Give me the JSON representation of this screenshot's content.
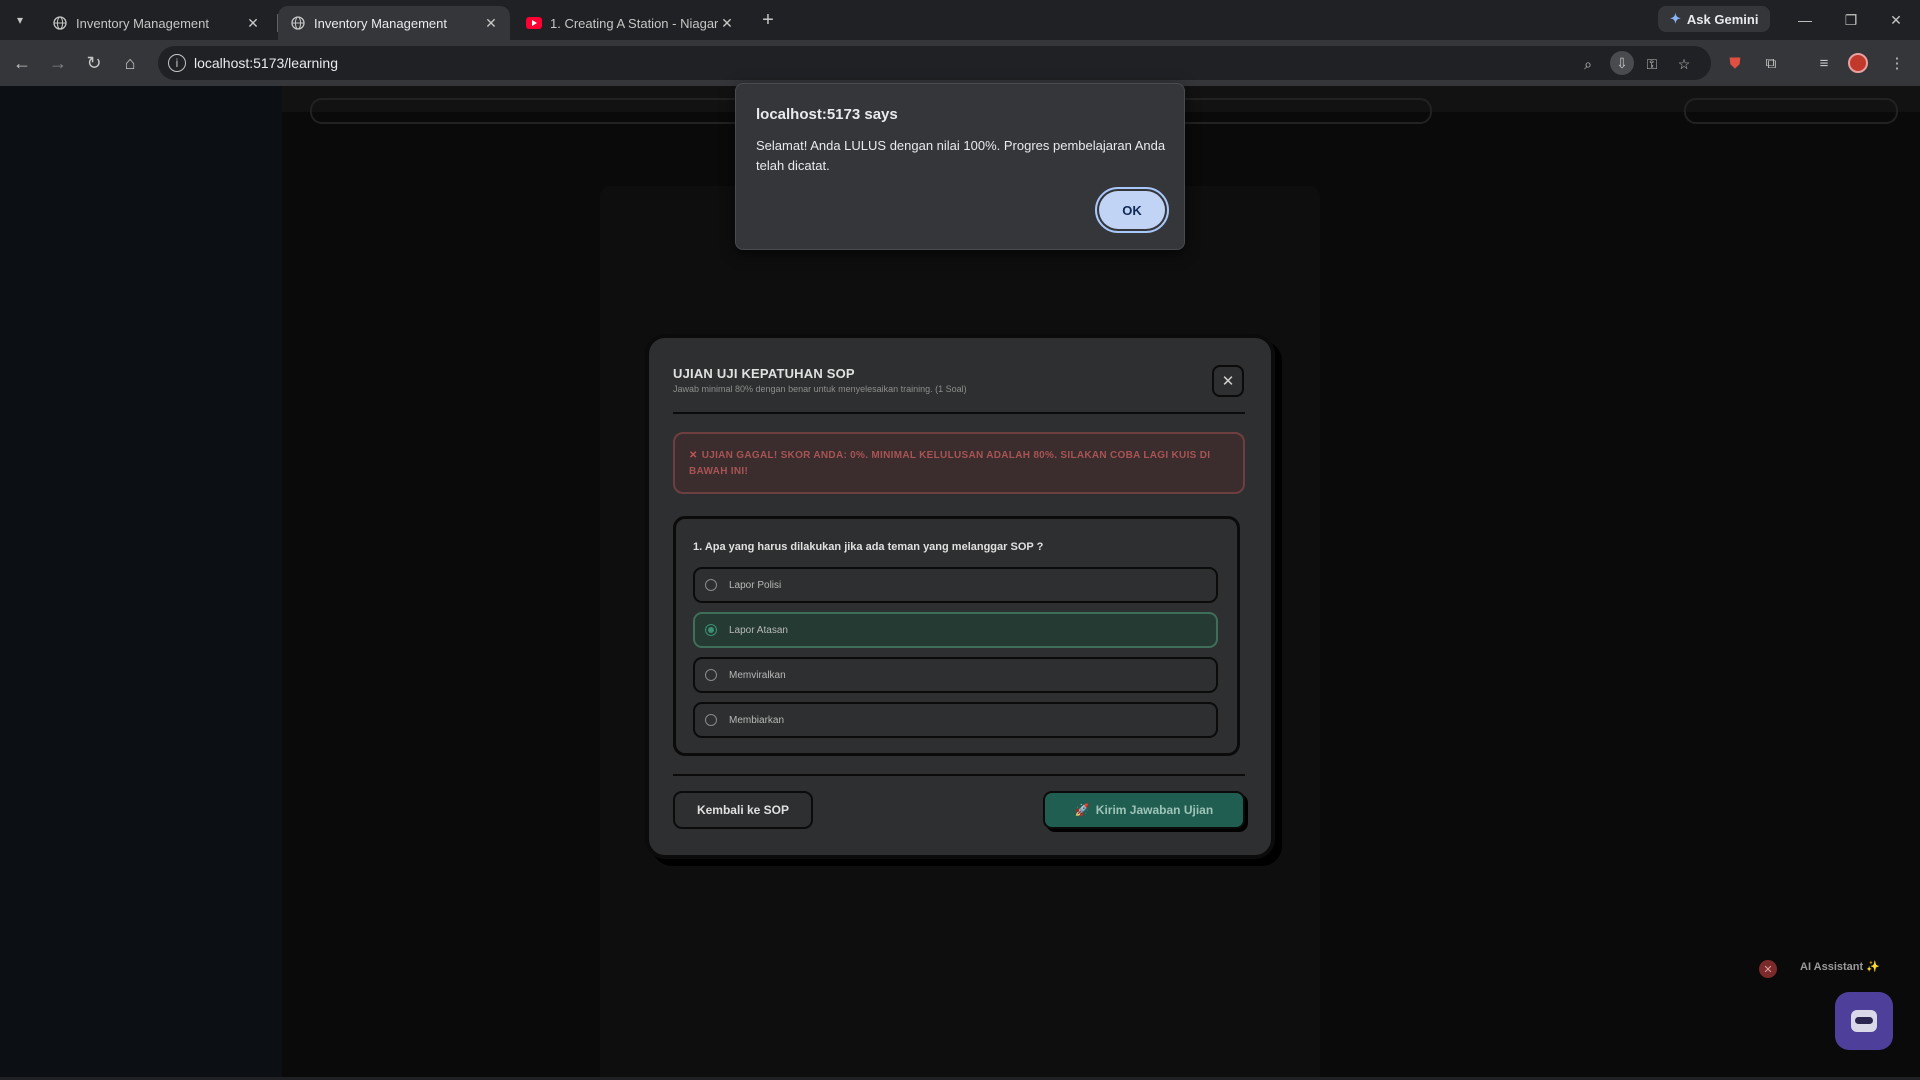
{
  "browser": {
    "tabs": [
      {
        "title": "Inventory Management",
        "favicon": "globe-icon",
        "active": false
      },
      {
        "title": "Inventory Management",
        "favicon": "globe-icon",
        "active": true
      },
      {
        "title": "1. Creating A Station - Niagara",
        "favicon": "youtube-icon",
        "active": false
      }
    ],
    "gemini_label": "Ask Gemini",
    "url": "localhost:5173/learning"
  },
  "dialog": {
    "title": "localhost:5173 says",
    "message": "Selamat! Anda LULUS dengan nilai 100%. Progres pembelajaran Anda telah dicatat.",
    "ok_label": "OK"
  },
  "quiz": {
    "title": "UJIAN UJI KEPATUHAN SOP",
    "subtitle": "Jawab minimal 80% dengan benar untuk menyelesaikan training. (1 Soal)",
    "alert": "UJIAN GAGAL! SKOR ANDA: 0%. MINIMAL KELULUSAN ADALAH 80%. SILAKAN COBA LAGI KUIS DI BAWAH INI!",
    "question": "1. Apa yang harus dilakukan jika ada teman yang melanggar SOP ?",
    "options": [
      "Lapor Polisi",
      "Lapor Atasan",
      "Memviralkan",
      "Membiarkan"
    ],
    "selected_option": "Lapor Atasan",
    "back_label": "Kembali ke SOP",
    "submit_label": "Kirim Jawaban Ujian"
  },
  "assistant": {
    "label": "AI Assistant ✨"
  },
  "colors": {
    "accent_green": "#1f5e50",
    "alert_red": "#a85454",
    "assistant_purple": "#4e3f9a",
    "dialog_button": "#c2d4f5"
  }
}
